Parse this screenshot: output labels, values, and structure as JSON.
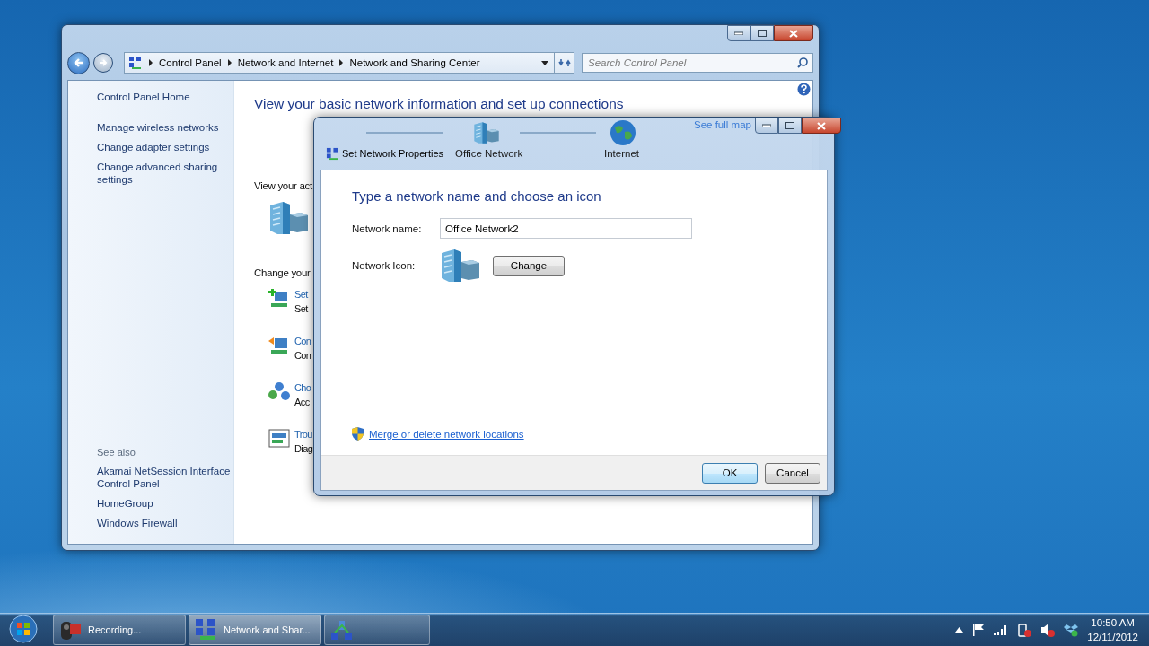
{
  "main_window": {
    "breadcrumbs": [
      "Control Panel",
      "Network and Internet",
      "Network and Sharing Center"
    ],
    "search": {
      "placeholder": "Search Control Panel"
    },
    "sidebar": {
      "items": [
        "Control Panel Home",
        "Manage wireless networks",
        "Change adapter settings",
        "Change advanced sharing settings"
      ],
      "see_also_heading": "See also",
      "see_also": [
        "Akamai NetSession Interface Control Panel",
        "HomeGroup",
        "Windows Firewall"
      ]
    },
    "heading": "View your basic network information and set up connections",
    "network_map": {
      "link": "See full map",
      "nodes": [
        {
          "kind": "building",
          "label": "Office Network"
        },
        {
          "kind": "globe",
          "label": "Internet"
        }
      ]
    },
    "sections": [
      "View your act",
      "Change your"
    ],
    "tasks": [
      {
        "kind": "add",
        "title": "Set",
        "description": "Set"
      },
      {
        "kind": "connect",
        "title": "Con",
        "description": "Con"
      },
      {
        "kind": "homegroup",
        "title": "Cho",
        "description": "Acc"
      },
      {
        "kind": "troubleshoot",
        "title": "Trou",
        "description": "Diag"
      }
    ]
  },
  "dialog": {
    "title": "Set Network Properties",
    "heading": "Type a network name and choose an icon",
    "name_label": "Network name:",
    "name_value": "Office Network2",
    "icon_label": "Network Icon:",
    "change_button": "Change",
    "link": "Merge or delete network locations",
    "buttons": [
      {
        "label": "OK",
        "default": true
      },
      {
        "label": "Cancel",
        "default": false
      }
    ]
  },
  "taskbar": {
    "items": [
      {
        "kind": "camera",
        "label": "Recording...",
        "selected": false
      },
      {
        "kind": "network",
        "label": "Network and Shar...",
        "selected": true
      },
      {
        "kind": "network-alt",
        "selected": false
      }
    ],
    "clock": {
      "time": "10:50 AM",
      "date": "12/11/2012"
    }
  }
}
